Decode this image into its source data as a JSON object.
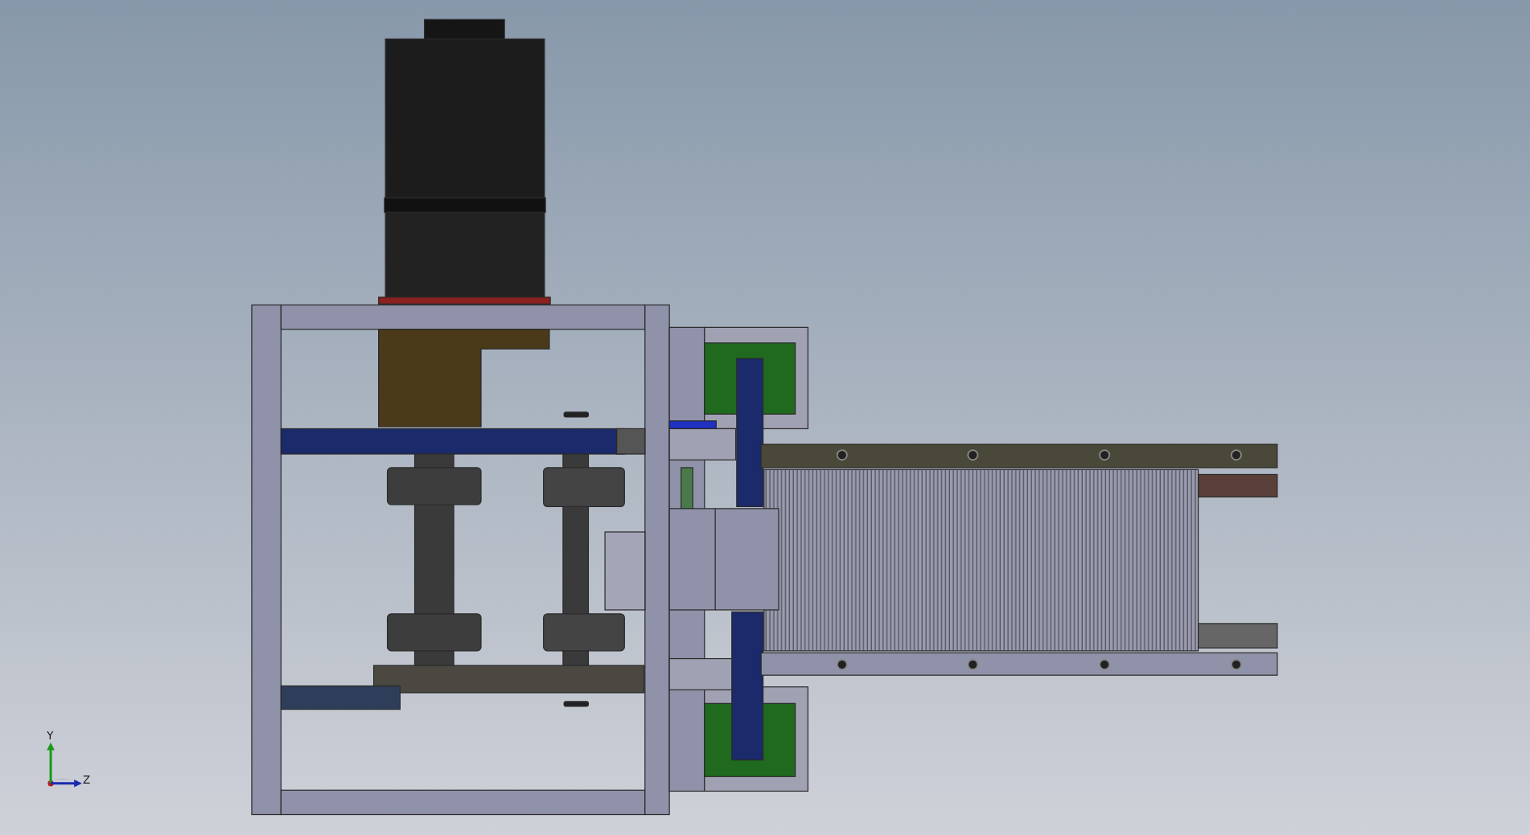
{
  "viewport": {
    "triad": {
      "axes": [
        {
          "label": "Y",
          "kind": "y"
        },
        {
          "label": "Z",
          "kind": "z"
        }
      ]
    }
  }
}
